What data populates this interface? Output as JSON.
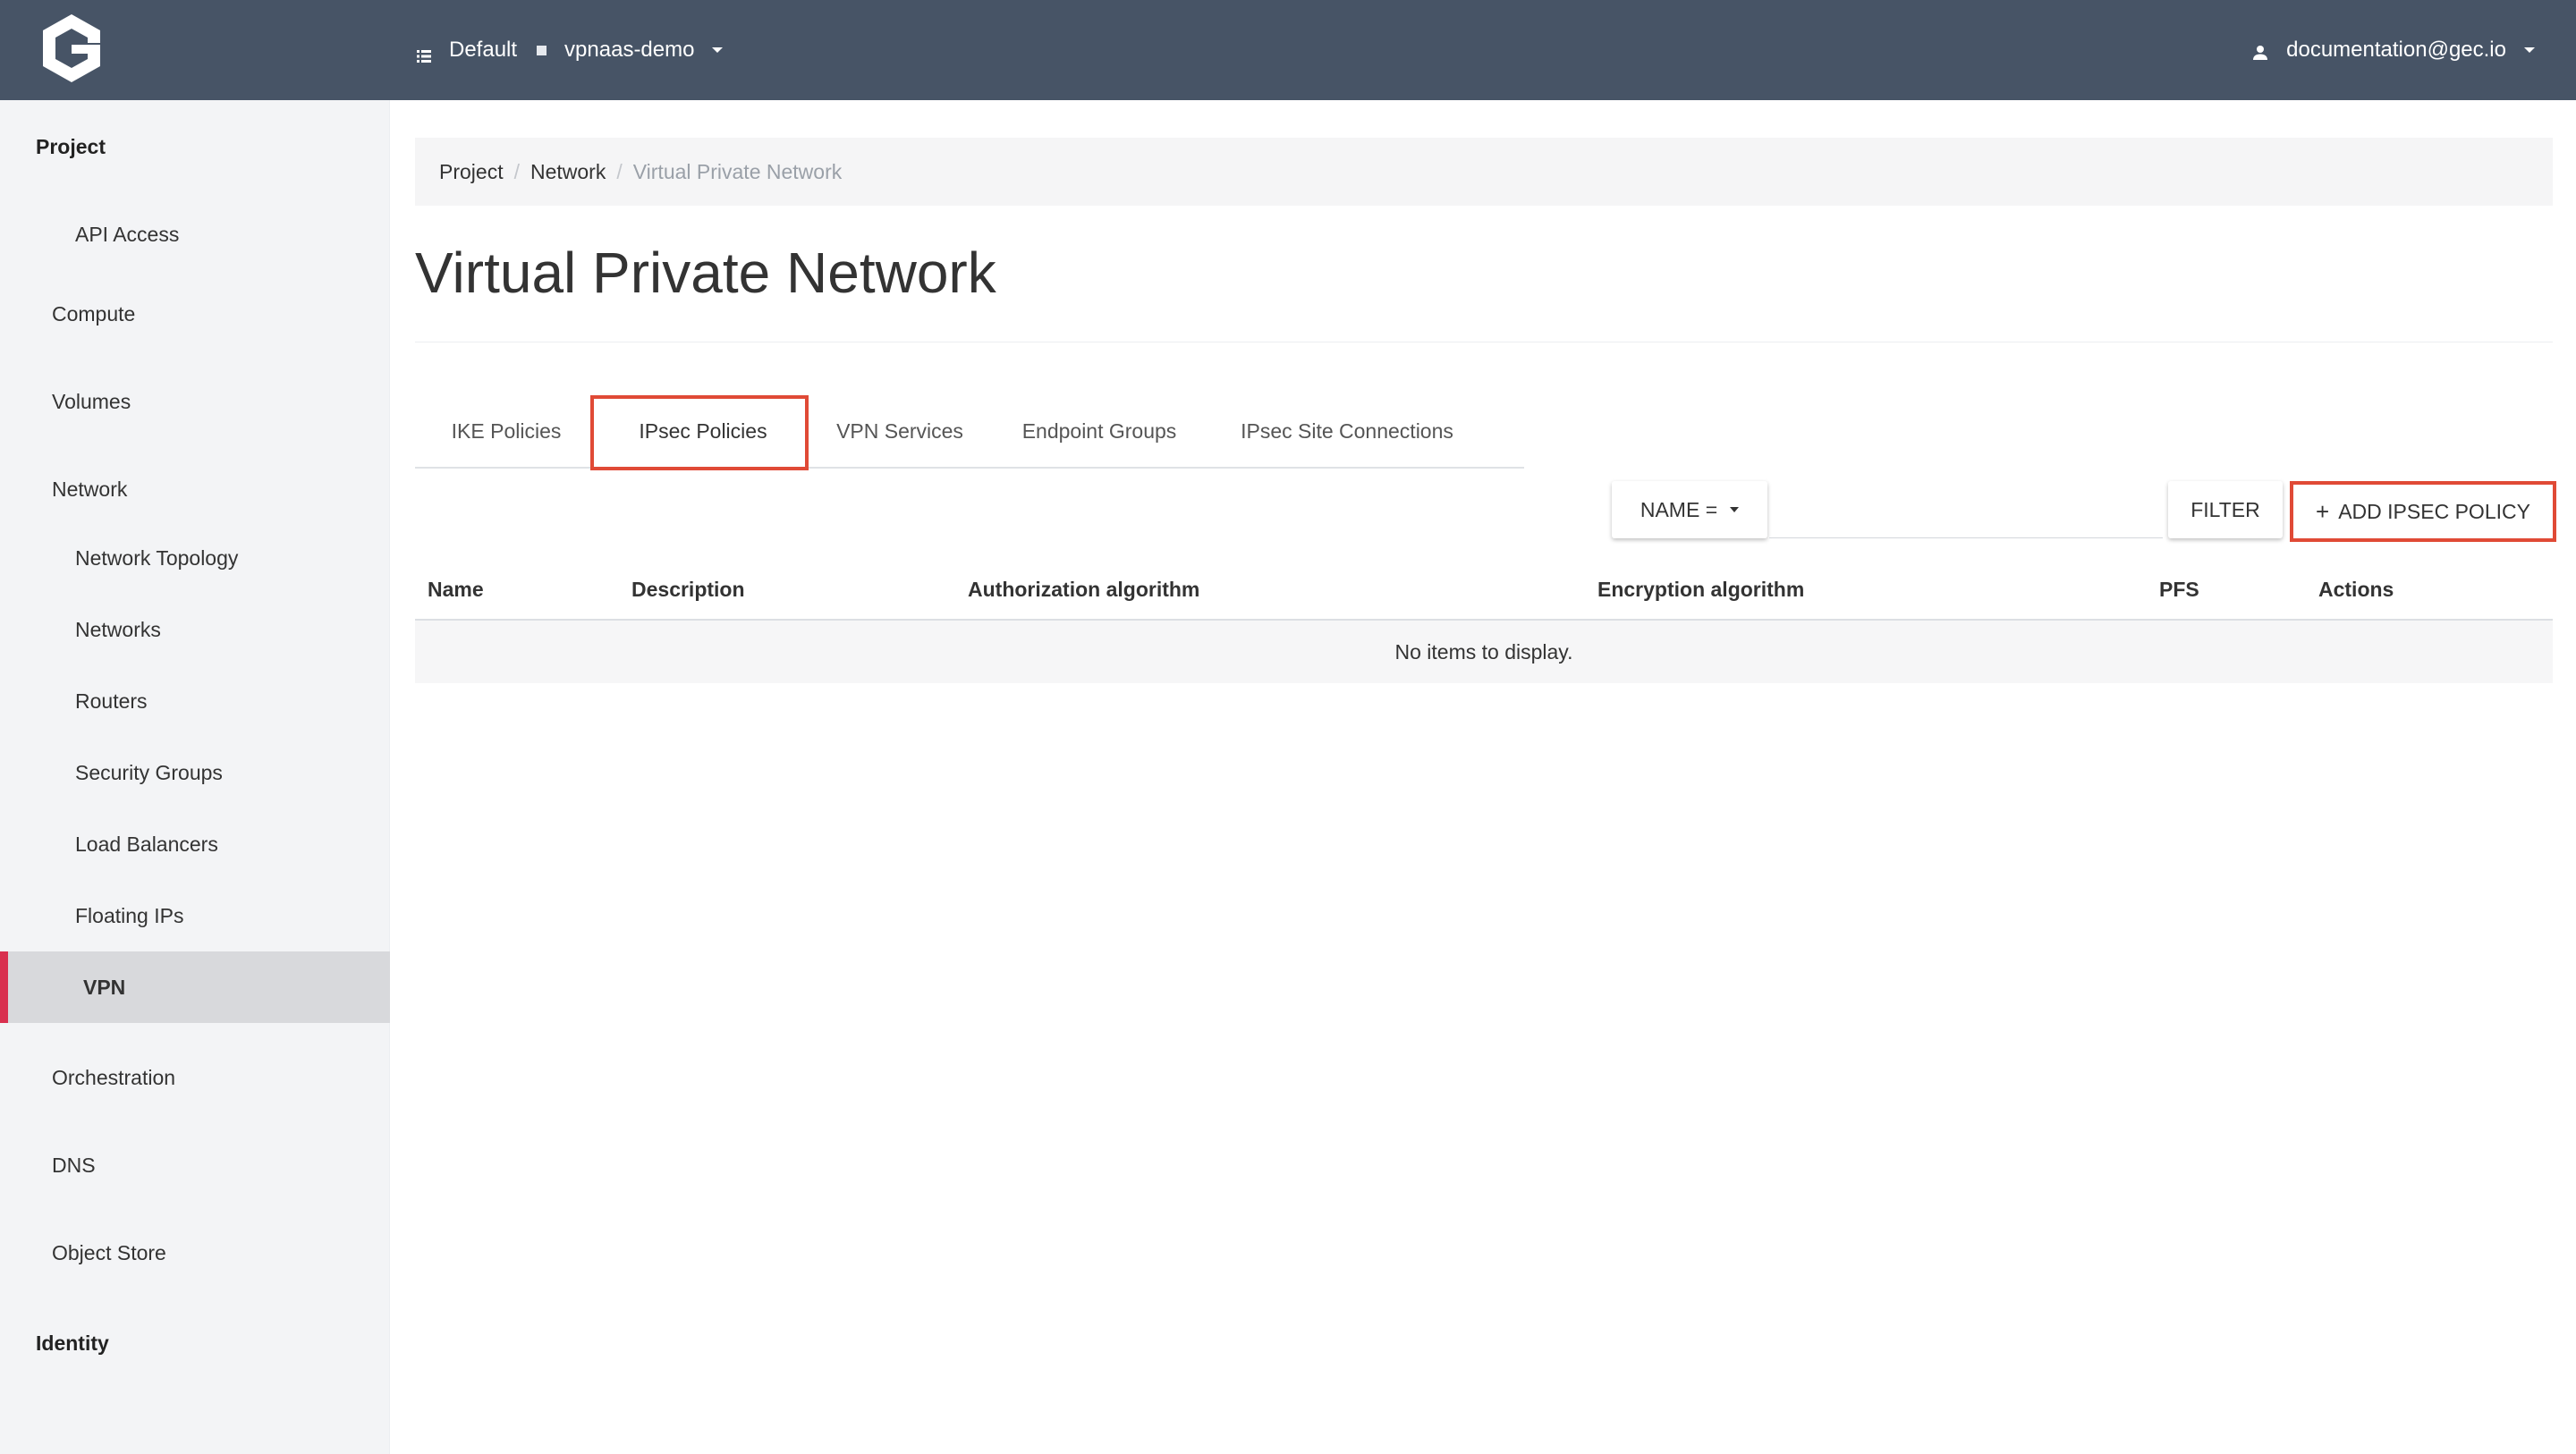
{
  "topbar": {
    "domain": "Default",
    "project": "vpnaas-demo",
    "user": "documentation@gec.io",
    "bg_color": "#475466"
  },
  "sidebar": {
    "project_label": "Project",
    "api_access": "API Access",
    "compute": "Compute",
    "volumes": "Volumes",
    "network": "Network",
    "network_topology": "Network Topology",
    "networks": "Networks",
    "routers": "Routers",
    "security_groups": "Security Groups",
    "load_balancers": "Load Balancers",
    "floating_ips": "Floating IPs",
    "vpn": "VPN",
    "orchestration": "Orchestration",
    "dns": "DNS",
    "object_store": "Object Store",
    "identity_label": "Identity",
    "active_accent": "#d9304f"
  },
  "breadcrumb": {
    "items": [
      "Project",
      "Network",
      "Virtual Private Network"
    ]
  },
  "page": {
    "title": "Virtual Private Network"
  },
  "tabs": [
    "IKE Policies",
    "IPsec Policies",
    "VPN Services",
    "Endpoint Groups",
    "IPsec Site Connections"
  ],
  "active_tab": "IPsec Policies",
  "toolbar": {
    "filter_field": "NAME =",
    "filter_value": "",
    "filter_button": "FILTER",
    "add_button": "ADD IPSEC POLICY"
  },
  "table": {
    "columns": [
      "Name",
      "Description",
      "Authorization algorithm",
      "Encryption algorithm",
      "PFS",
      "Actions"
    ],
    "empty_message": "No items to display."
  },
  "highlight_color": "#e04a36"
}
